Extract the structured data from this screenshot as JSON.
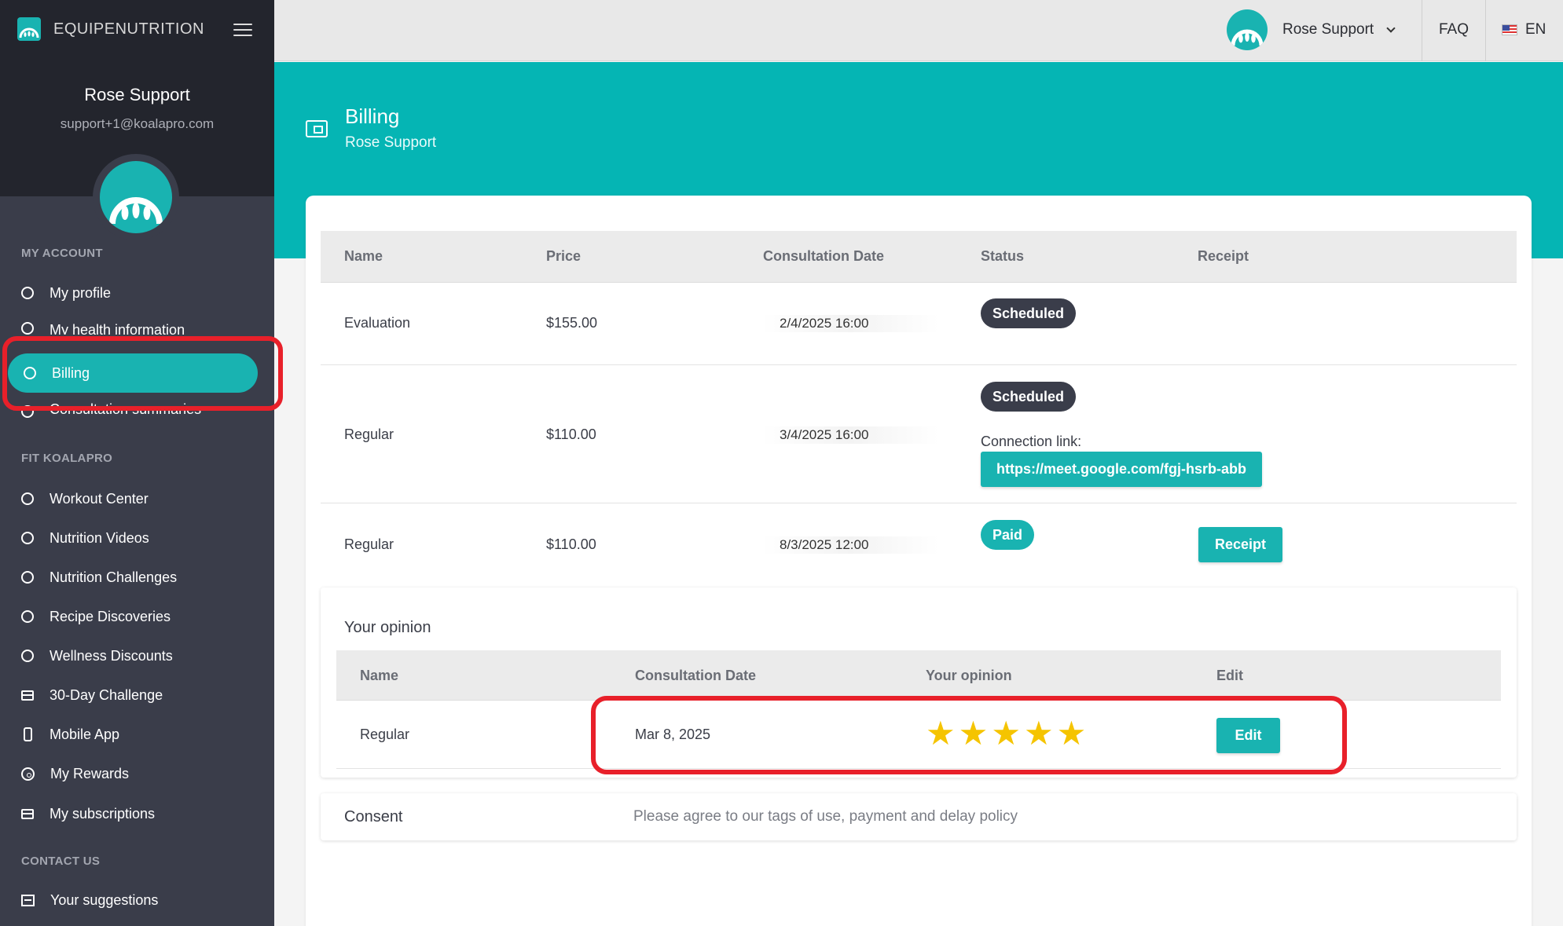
{
  "brand": {
    "name": "EQUIPENUTRITION"
  },
  "user": {
    "name": "Rose Support",
    "email": "support+1@koalapro.com"
  },
  "sidebar": {
    "sections": [
      {
        "title": "MY ACCOUNT"
      },
      {
        "title": "FIT KOALAPRO"
      },
      {
        "title": "CONTACT US"
      }
    ],
    "items": [
      {
        "label": "My profile",
        "icon": "circle-icon"
      },
      {
        "label": "My health information",
        "icon": "circle-icon"
      },
      {
        "label": "Billing",
        "icon": "circle-icon",
        "active": true
      },
      {
        "label": "Consultation summaries",
        "icon": "circle-icon"
      },
      {
        "label": "Workout Center",
        "icon": "circle-icon"
      },
      {
        "label": "Nutrition Videos",
        "icon": "circle-icon"
      },
      {
        "label": "Nutrition Challenges",
        "icon": "circle-icon"
      },
      {
        "label": "Recipe Discoveries",
        "icon": "circle-icon"
      },
      {
        "label": "Wellness Discounts",
        "icon": "circle-icon"
      },
      {
        "label": "30-Day Challenge",
        "icon": "calendar-icon"
      },
      {
        "label": "Mobile App",
        "icon": "phone-icon"
      },
      {
        "label": "My Rewards",
        "icon": "rewards-icon"
      },
      {
        "label": "My subscriptions",
        "icon": "calendar-icon"
      },
      {
        "label": "Your suggestions",
        "icon": "suggestion-icon"
      }
    ]
  },
  "topbar": {
    "user": "Rose Support",
    "faq": "FAQ",
    "lang": "EN"
  },
  "header": {
    "title": "Billing",
    "subtitle": "Rose Support"
  },
  "billing": {
    "columns": [
      "Name",
      "Price",
      "Consultation Date",
      "Status",
      "Receipt"
    ],
    "rows": [
      {
        "name": "Evaluation",
        "price": "$155.00",
        "date": "2/4/2025 16:00",
        "status": "Scheduled"
      },
      {
        "name": "Regular",
        "price": "$110.00",
        "date": "3/4/2025 16:00",
        "status": "Scheduled",
        "connection_label": "Connection link:",
        "connection_link": "https://meet.google.com/fgj-hsrb-abb"
      },
      {
        "name": "Regular",
        "price": "$110.00",
        "date": "8/3/2025 12:00",
        "status": "Paid",
        "receipt_label": "Receipt"
      }
    ]
  },
  "opinion": {
    "title": "Your opinion",
    "columns": [
      "Name",
      "Consultation Date",
      "Your opinion",
      "Edit"
    ],
    "rows": [
      {
        "name": "Regular",
        "date": "Mar 8, 2025",
        "rating": 5,
        "edit_label": "Edit"
      }
    ]
  },
  "consent": {
    "label": "Consent",
    "text": "Please agree to our tags of use, payment and delay policy"
  },
  "colors": {
    "accent": "#19b3b1",
    "sidebar": "#3a3d4a",
    "highlight": "#e8202a",
    "star": "#f5c400"
  }
}
